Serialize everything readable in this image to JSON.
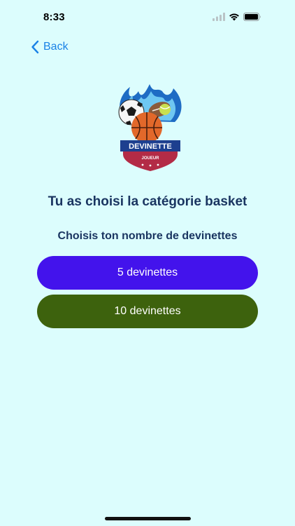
{
  "status_bar": {
    "time": "8:33",
    "icons": [
      "signal-icon",
      "wifi-icon",
      "battery-icon"
    ]
  },
  "nav": {
    "back_label": "Back"
  },
  "logo": {
    "wordmark": "DEVINETTE",
    "sub_wordmark": "JOUEUR"
  },
  "content": {
    "title": "Tu as choisi la catégorie basket",
    "subtitle": "Choisis ton nombre de devinettes"
  },
  "choices": [
    {
      "label": "5 devinettes",
      "color": "#4313ec"
    },
    {
      "label": "10 devinettes",
      "color": "#3d620d"
    }
  ],
  "colors": {
    "background": "#dcfdfd",
    "accent_link": "#1a82e6",
    "heading": "#1a3561"
  }
}
